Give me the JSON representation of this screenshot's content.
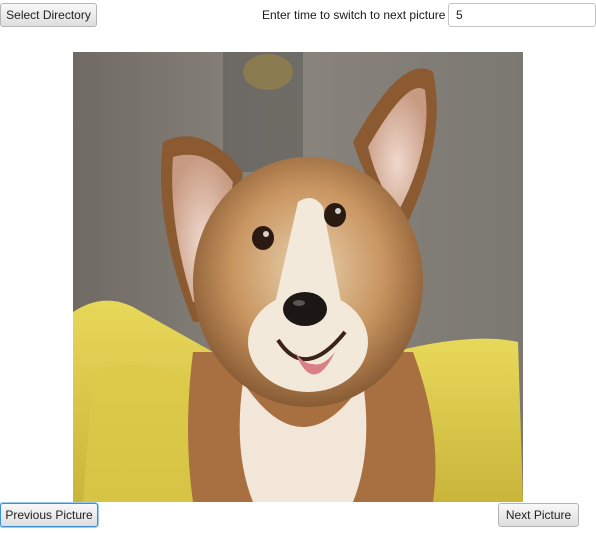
{
  "toolbar": {
    "select_directory_label": "Select Directory",
    "time_label": "Enter time to switch to next picture",
    "time_value": "5"
  },
  "picture": {
    "subject_icon": "corgi-photo"
  },
  "footer": {
    "previous_label": "Previous Picture",
    "next_label": "Next Picture"
  },
  "colors": {
    "focus_border": "#3c8fd3",
    "button_top": "#f8f8f8",
    "button_bottom": "#dedede"
  }
}
